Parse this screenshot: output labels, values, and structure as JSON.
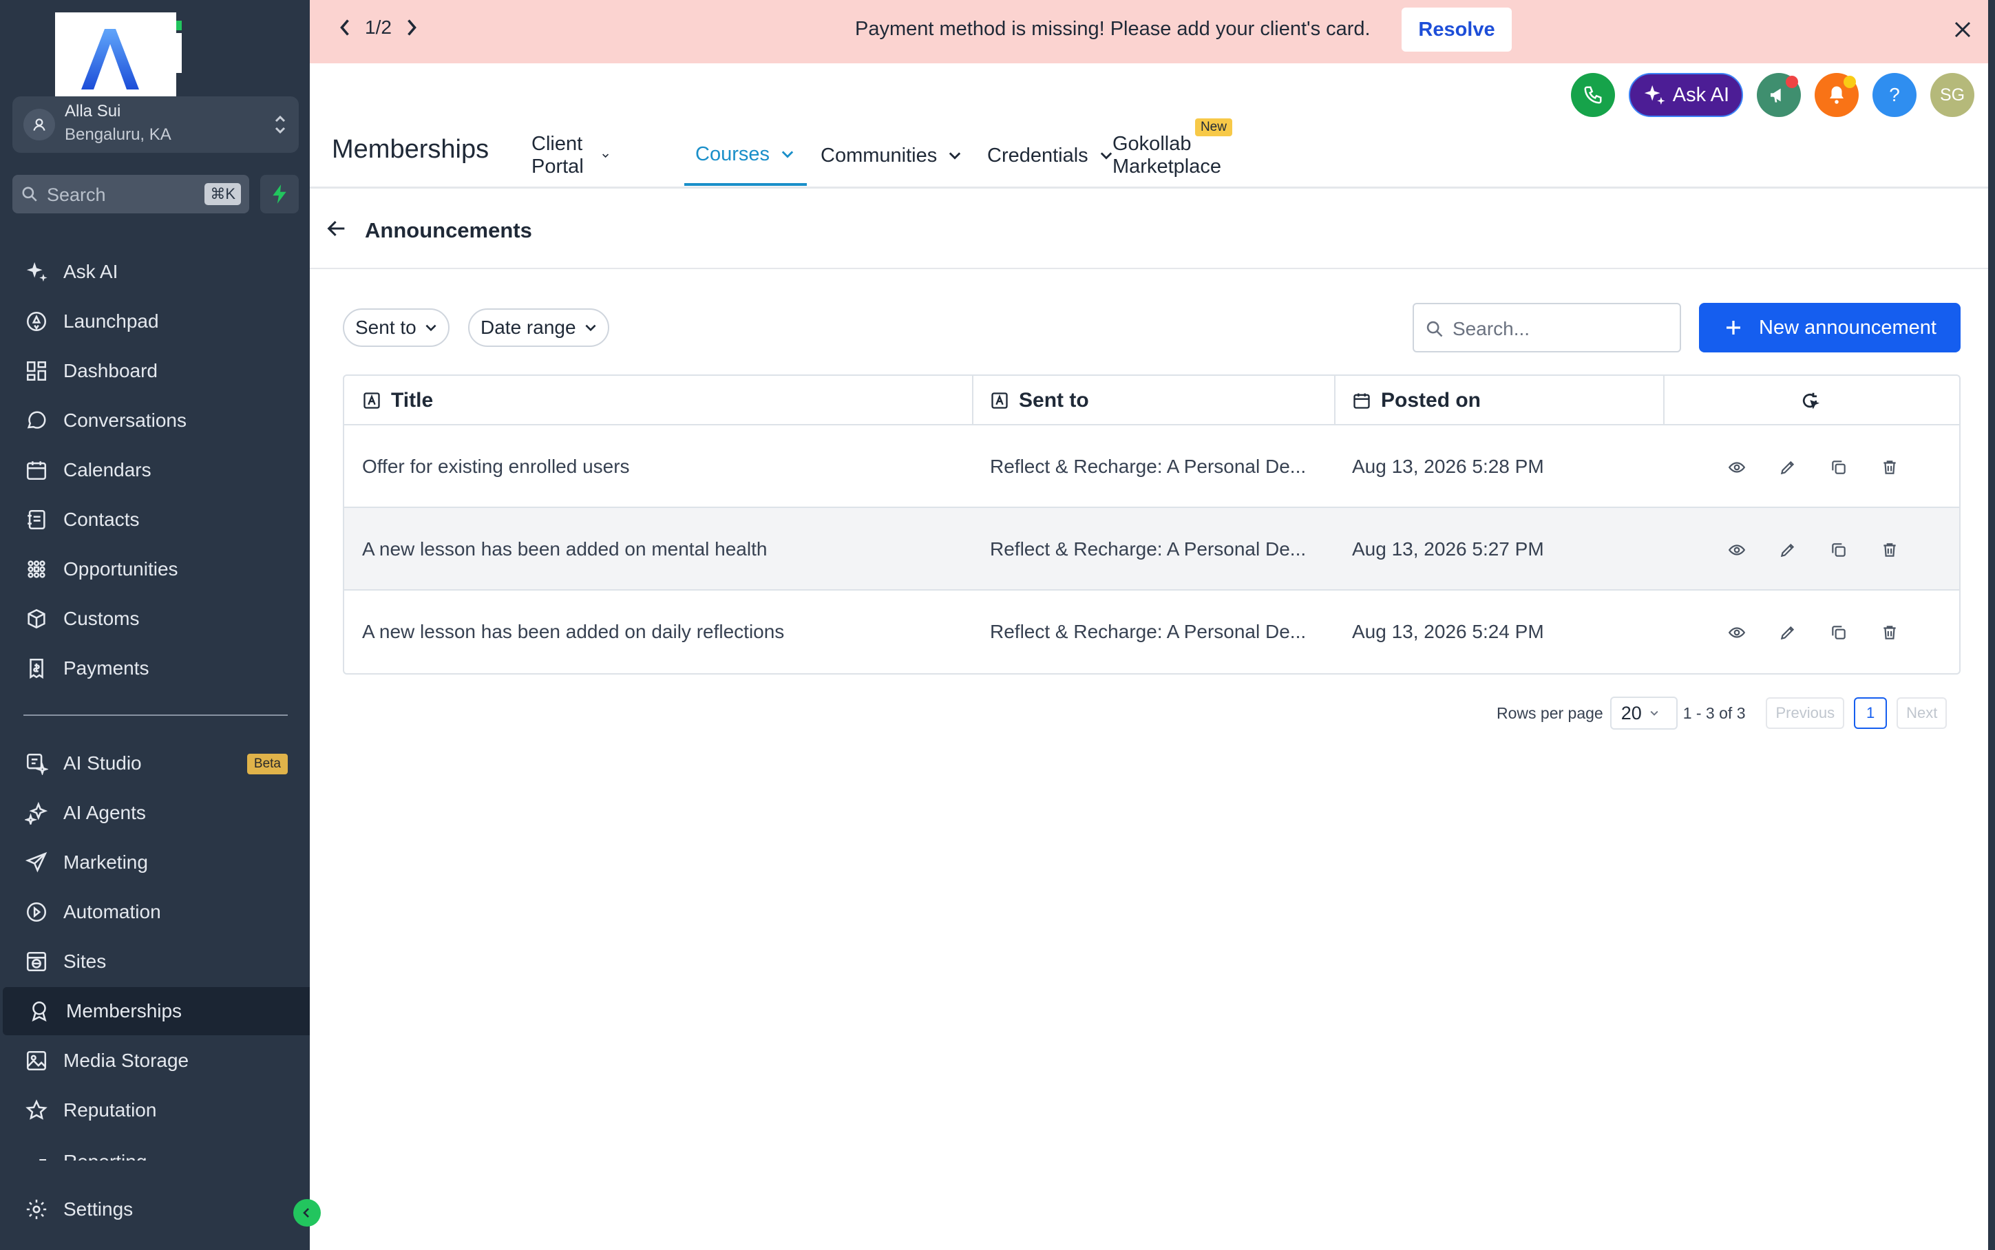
{
  "sidebar": {
    "account": {
      "name": "Alla Sui",
      "location": "Bengaluru, KA"
    },
    "search": {
      "placeholder": "Search",
      "shortcut": "⌘K"
    },
    "nav_primary": [
      {
        "label": "Ask AI",
        "icon": "sparkle-icon"
      },
      {
        "label": "Launchpad",
        "icon": "rocket-icon"
      },
      {
        "label": "Dashboard",
        "icon": "grid-icon"
      },
      {
        "label": "Conversations",
        "icon": "chat-icon"
      },
      {
        "label": "Calendars",
        "icon": "calendar-icon"
      },
      {
        "label": "Contacts",
        "icon": "contacts-icon"
      },
      {
        "label": "Opportunities",
        "icon": "funnel-icon"
      },
      {
        "label": "Customs",
        "icon": "box-icon"
      },
      {
        "label": "Payments",
        "icon": "receipt-icon"
      }
    ],
    "nav_secondary": [
      {
        "label": "AI Studio",
        "icon": "ai-studio-icon",
        "badge": "Beta"
      },
      {
        "label": "AI Agents",
        "icon": "ai-agents-icon"
      },
      {
        "label": "Marketing",
        "icon": "send-icon"
      },
      {
        "label": "Automation",
        "icon": "automation-icon"
      },
      {
        "label": "Sites",
        "icon": "globe-icon"
      },
      {
        "label": "Memberships",
        "icon": "award-icon",
        "active": true
      },
      {
        "label": "Media Storage",
        "icon": "image-icon"
      },
      {
        "label": "Reputation",
        "icon": "star-icon"
      },
      {
        "label": "Reporting",
        "icon": "chart-icon"
      }
    ],
    "settings_label": "Settings"
  },
  "banner": {
    "pager": "1/2",
    "message": "Payment method is missing! Please add your client's card.",
    "resolve_label": "Resolve"
  },
  "header": {
    "ask_ai_label": "Ask AI",
    "avatar_initials": "SG",
    "help_label": "?",
    "page_title": "Memberships",
    "tabs": [
      {
        "label": "Client Portal",
        "dropdown": true
      },
      {
        "label": "Courses",
        "dropdown": true,
        "active": true
      },
      {
        "label": "Communities",
        "dropdown": true
      },
      {
        "label": "Credentials",
        "dropdown": true
      },
      {
        "label": "Gokollab Marketplace",
        "badge": "New"
      }
    ]
  },
  "subheader": {
    "title": "Announcements"
  },
  "toolbar": {
    "filters": [
      "Sent to",
      "Date range"
    ],
    "search_placeholder": "Search...",
    "new_button_label": "New announcement"
  },
  "table": {
    "columns": [
      "Title",
      "Sent to",
      "Posted on"
    ],
    "rows": [
      {
        "title": "Offer for existing enrolled users",
        "sent_to": "Reflect & Recharge: A Personal De...",
        "posted_on": "Aug 13, 2026 5:28 PM"
      },
      {
        "title": "A new lesson has been added on mental health",
        "sent_to": "Reflect & Recharge: A Personal De...",
        "posted_on": "Aug 13, 2026 5:27 PM"
      },
      {
        "title": "A new lesson has been added on daily reflections",
        "sent_to": "Reflect & Recharge: A Personal De...",
        "posted_on": "Aug 13, 2026 5:24 PM"
      }
    ],
    "row_actions": [
      "eye-icon",
      "pencil-icon",
      "copy-icon",
      "trash-icon"
    ]
  },
  "pagination": {
    "rows_per_page_label": "Rows per page",
    "rows_per_page": "20",
    "range": "1 - 3 of 3",
    "previous_label": "Previous",
    "current_page": "1",
    "next_label": "Next"
  },
  "colors": {
    "sidebar_bg": "#2a3646",
    "banner_bg": "#fbd3d0",
    "primary": "#155eef",
    "active_tab": "#1a8fc9",
    "beta_badge": "#e0b34a"
  }
}
